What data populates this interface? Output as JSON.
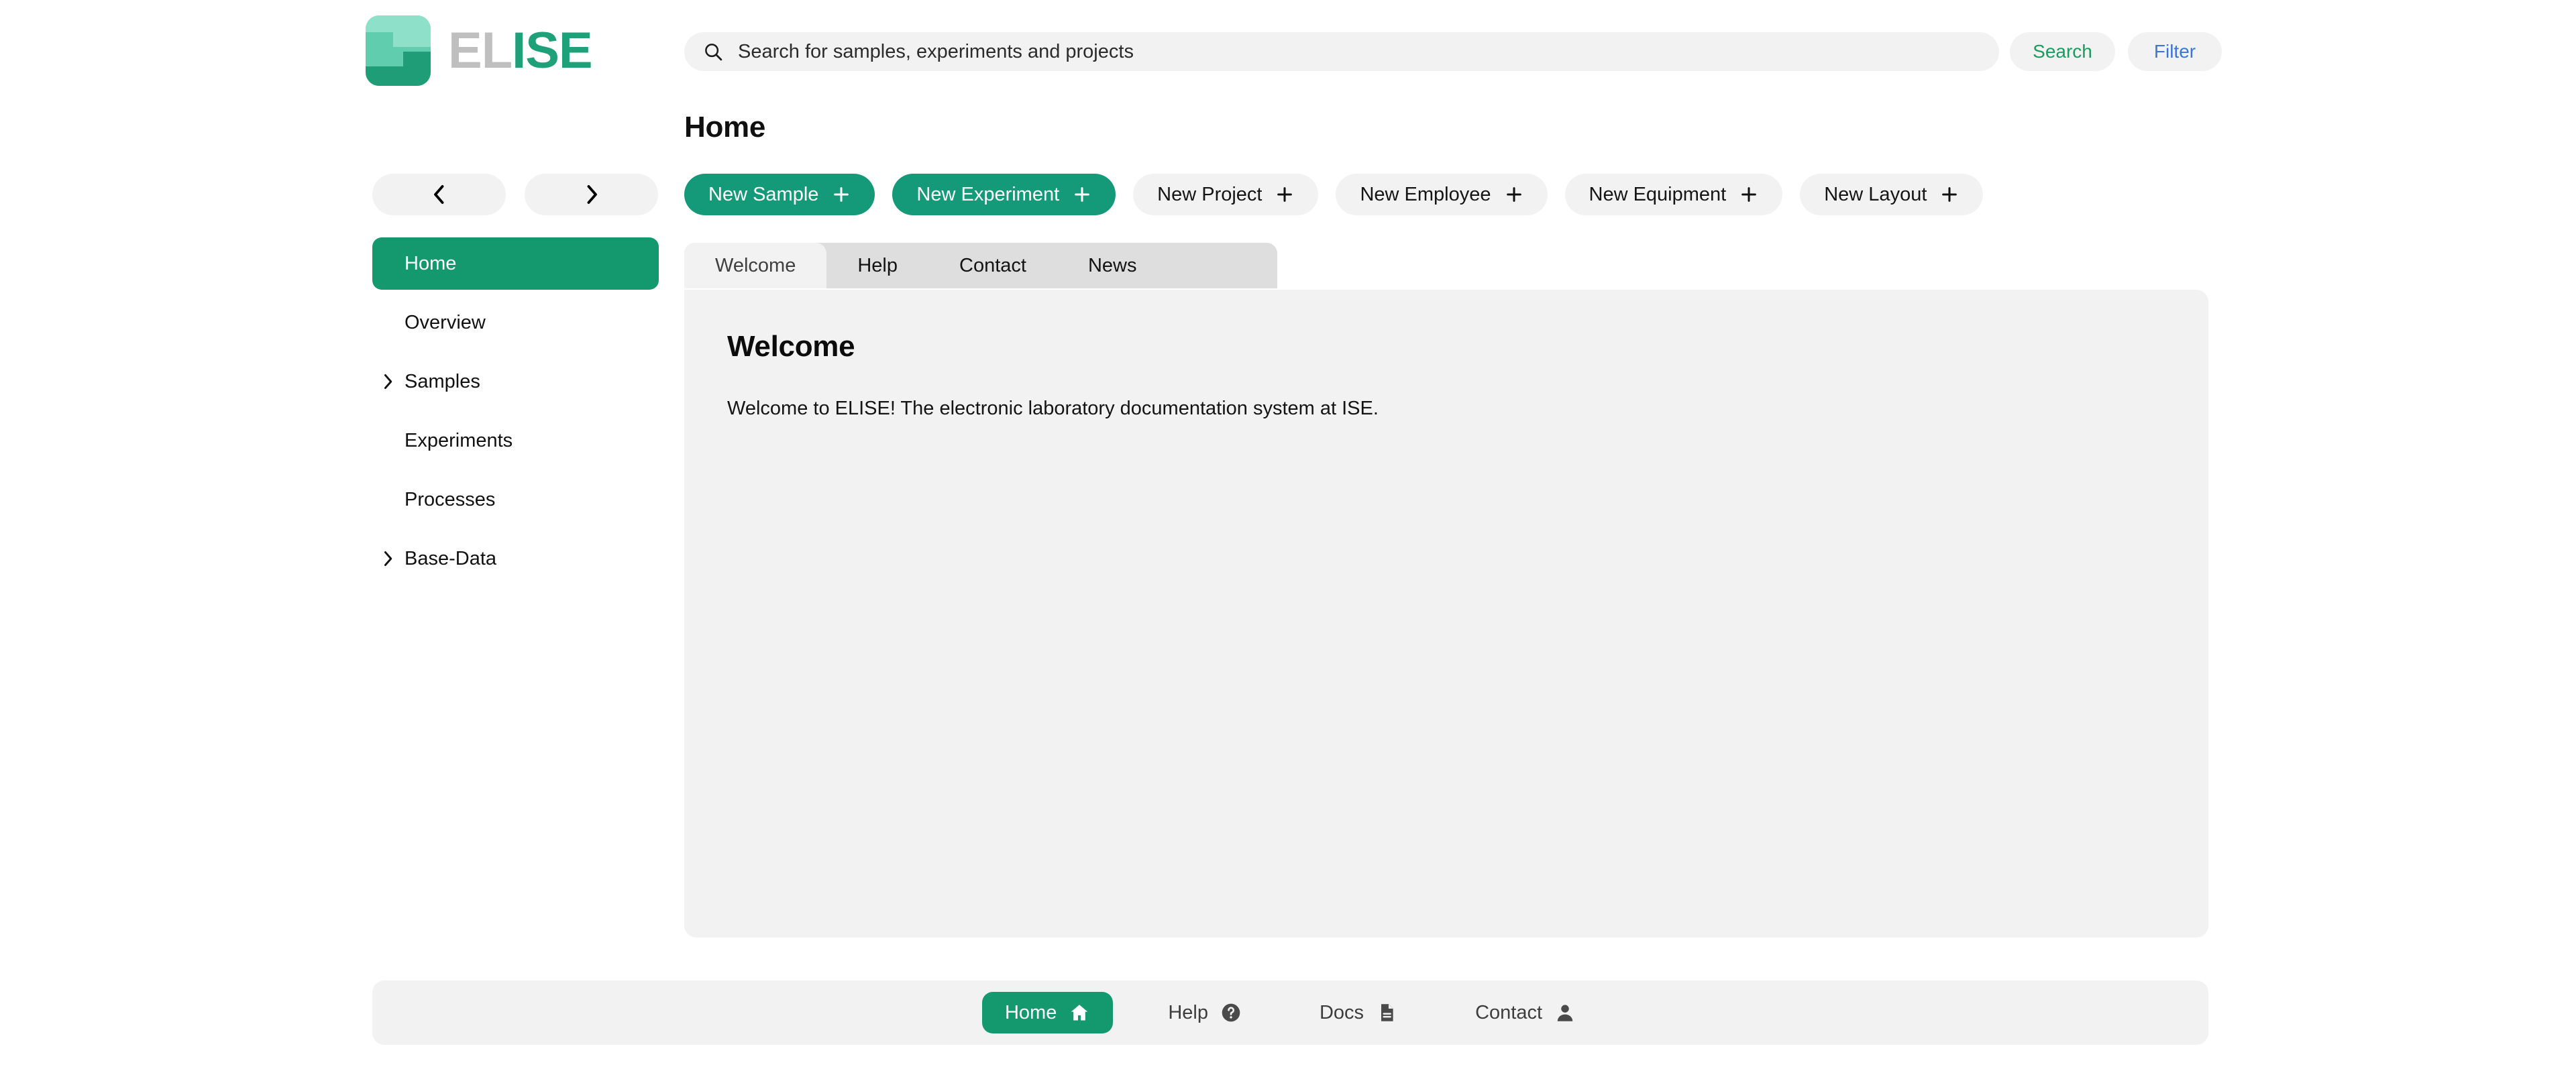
{
  "app": {
    "name": "ELISE",
    "logo_text_gray": "EL",
    "logo_text_green": "ISE",
    "accent_green": "#14996f",
    "search_text_color": "#1b9c5e",
    "filter_text_color": "#3a77d4"
  },
  "header": {
    "search": {
      "placeholder": "Search for samples, experiments and projects",
      "value": "",
      "icon": "search-icon"
    },
    "search_button": "Search",
    "filter_button": "Filter"
  },
  "page": {
    "title": "Home"
  },
  "actions": [
    {
      "label": "New Sample",
      "icon": "plus-icon",
      "primary": true
    },
    {
      "label": "New Experiment",
      "icon": "plus-icon",
      "primary": true
    },
    {
      "label": "New Project",
      "icon": "plus-icon",
      "primary": false
    },
    {
      "label": "New Employee",
      "icon": "plus-icon",
      "primary": false
    },
    {
      "label": "New Equipment",
      "icon": "plus-icon",
      "primary": false
    },
    {
      "label": "New Layout",
      "icon": "plus-icon",
      "primary": false
    }
  ],
  "sidebar": {
    "back_icon": "chevron-left-icon",
    "forward_icon": "chevron-right-icon",
    "items": [
      {
        "label": "Home",
        "active": true,
        "expandable": false
      },
      {
        "label": "Overview",
        "active": false,
        "expandable": false
      },
      {
        "label": "Samples",
        "active": false,
        "expandable": true
      },
      {
        "label": "Experiments",
        "active": false,
        "expandable": false
      },
      {
        "label": "Processes",
        "active": false,
        "expandable": false
      },
      {
        "label": "Base-Data",
        "active": false,
        "expandable": true
      }
    ]
  },
  "tabs": [
    {
      "label": "Welcome",
      "active": true
    },
    {
      "label": "Help",
      "active": false
    },
    {
      "label": "Contact",
      "active": false
    },
    {
      "label": "News",
      "active": false
    }
  ],
  "main": {
    "heading": "Welcome",
    "paragraph": "Welcome to ELISE! The electronic laboratory documentation system at ISE."
  },
  "footer": {
    "items": [
      {
        "label": "Home",
        "icon": "home-icon",
        "active": true
      },
      {
        "label": "Help",
        "icon": "help-circle-icon",
        "active": false
      },
      {
        "label": "Docs",
        "icon": "document-icon",
        "active": false
      },
      {
        "label": "Contact",
        "icon": "person-icon",
        "active": false
      }
    ]
  }
}
